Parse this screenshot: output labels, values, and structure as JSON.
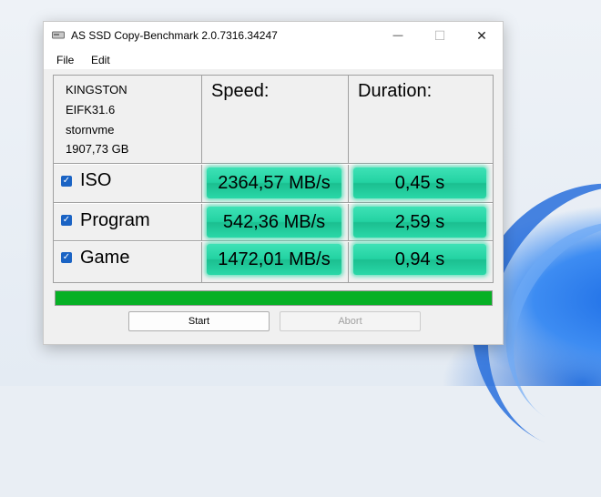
{
  "window": {
    "title": "AS SSD Copy-Benchmark 2.0.7316.34247",
    "minimize_glyph": "—",
    "maximize_glyph": "☐",
    "close_glyph": "✕"
  },
  "menu": {
    "items": [
      "File",
      "Edit"
    ]
  },
  "drive_info": {
    "model": "KINGSTON",
    "firmware": "EIFK31.6",
    "driver": "stornvme",
    "capacity": "1907,73 GB"
  },
  "columns": {
    "speed": "Speed:",
    "duration": "Duration:"
  },
  "rows": [
    {
      "label": "ISO",
      "checked": true,
      "speed": "2364,57 MB/s",
      "duration": "0,45 s"
    },
    {
      "label": "Program",
      "checked": true,
      "speed": "542,36 MB/s",
      "duration": "2,59 s"
    },
    {
      "label": "Game",
      "checked": true,
      "speed": "1472,01 MB/s",
      "duration": "0,94 s"
    }
  ],
  "progress": {
    "value": 1.0,
    "color": "#06b025"
  },
  "buttons": {
    "start": "Start",
    "abort": "Abort"
  },
  "colors": {
    "result_bg": "#23d2a2",
    "checkbox": "#1a63c4"
  }
}
